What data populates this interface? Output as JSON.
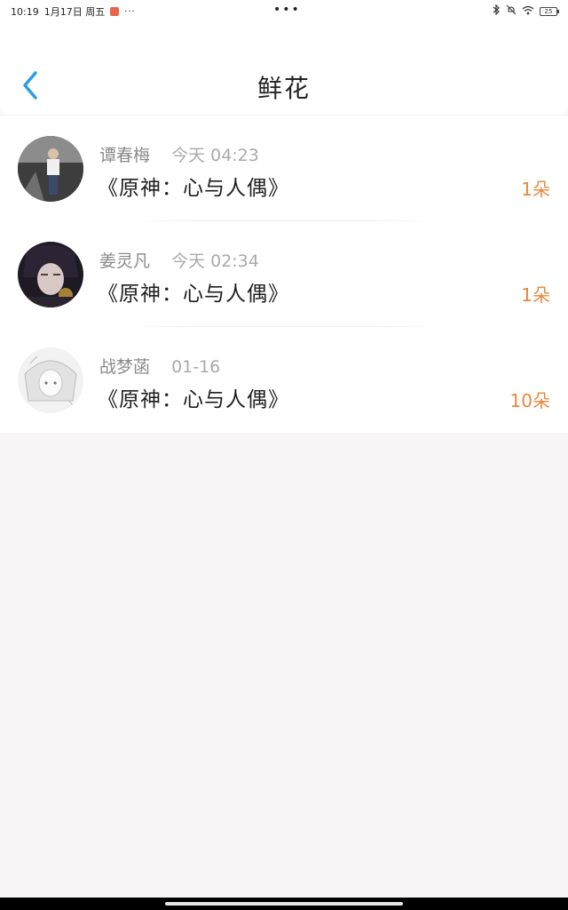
{
  "status_bar": {
    "time": "10:19",
    "date": "1月17日 周五",
    "more_small": "···",
    "center_dots": "•••",
    "battery": "25"
  },
  "header": {
    "title": "鲜花"
  },
  "records": [
    {
      "name": "谭春梅",
      "time": "今天 04:23",
      "book": "《原神：心与人偶》",
      "count": "1朵",
      "avatar": "avatar-photo-man"
    },
    {
      "name": "姜灵凡",
      "time": "今天 02:34",
      "book": "《原神：心与人偶》",
      "count": "1朵",
      "avatar": "avatar-anime-dark"
    },
    {
      "name": "战梦菡",
      "time": "01-16",
      "book": "《原神：心与人偶》",
      "count": "10朵",
      "avatar": "avatar-anime-sketch"
    }
  ],
  "colors": {
    "accent_blue": "#2a9de8",
    "count_orange": "#e6883e",
    "background": "#f8f6f6"
  }
}
